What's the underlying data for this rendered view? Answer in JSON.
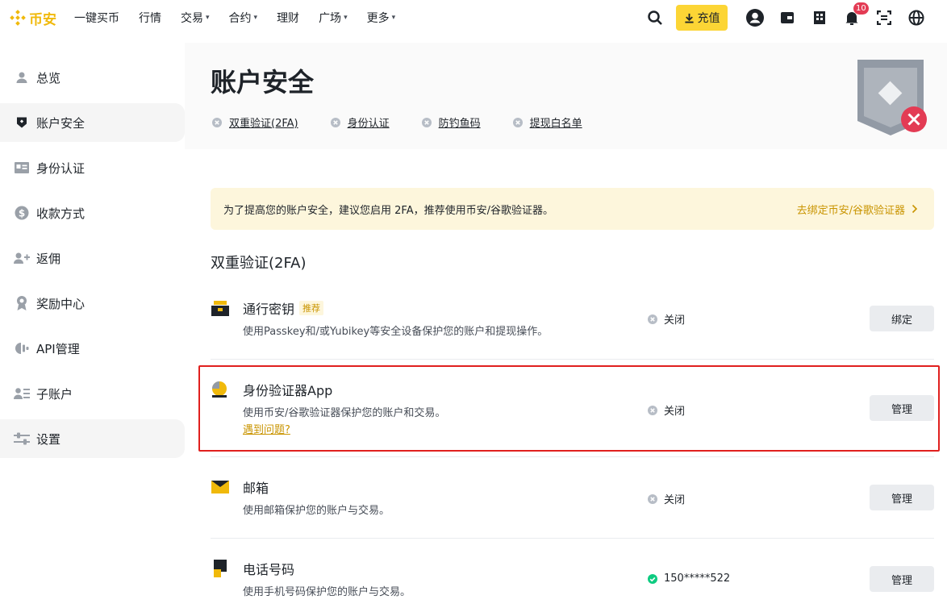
{
  "topbar": {
    "logo_text": "币安",
    "nav": [
      {
        "label": "一键买币",
        "has_menu": false
      },
      {
        "label": "行情",
        "has_menu": false
      },
      {
        "label": "交易",
        "has_menu": true
      },
      {
        "label": "合约",
        "has_menu": true
      },
      {
        "label": "理财",
        "has_menu": false
      },
      {
        "label": "广场",
        "has_menu": true
      },
      {
        "label": "更多",
        "has_menu": true
      }
    ],
    "deposit_label": "充值",
    "notification_count": "10",
    "accent_color": "#F0B90B"
  },
  "sidebar": {
    "items": [
      {
        "label": "总览",
        "icon": "user-icon",
        "active": false
      },
      {
        "label": "账户安全",
        "icon": "shield-icon",
        "active": true
      },
      {
        "label": "身份认证",
        "icon": "id-card-icon",
        "active": false
      },
      {
        "label": "收款方式",
        "icon": "dollar-icon",
        "active": false
      },
      {
        "label": "返佣",
        "icon": "add-user-icon",
        "active": false
      },
      {
        "label": "奖励中心",
        "icon": "medal-icon",
        "active": false
      },
      {
        "label": "API管理",
        "icon": "api-icon",
        "active": false
      },
      {
        "label": "子账户",
        "icon": "sub-account-icon",
        "active": false
      },
      {
        "label": "设置",
        "icon": "sliders-icon",
        "active": false
      }
    ]
  },
  "header": {
    "title": "账户安全",
    "checks": [
      {
        "label": "双重验证(2FA)"
      },
      {
        "label": "身份认证"
      },
      {
        "label": "防钓鱼码"
      },
      {
        "label": "提现白名单"
      }
    ]
  },
  "alert": {
    "message": "为了提高您的账户安全，建议您启用 2FA，推荐使用币安/谷歌验证器。",
    "link": "去绑定币安/谷歌验证器"
  },
  "section": {
    "title": "双重验证(2FA)",
    "rows": [
      {
        "title": "通行密钥",
        "tag": "推荐",
        "desc": "使用Passkey和/或Yubikey等安全设备保护您的账户和提现操作。",
        "status": "关闭",
        "button": "绑定"
      },
      {
        "title": "身份验证器App",
        "desc": "使用币安/谷歌验证器保护您的账户和交易。",
        "link": "遇到问题?",
        "status": "关闭",
        "button": "管理"
      },
      {
        "title": "邮箱",
        "desc": "使用邮箱保护您的账户与交易。",
        "status": "关闭",
        "button": "管理"
      },
      {
        "title": "电话号码",
        "desc": "使用手机号码保护您的账户与交易。",
        "status": "150*****522",
        "button": "管理"
      }
    ]
  }
}
